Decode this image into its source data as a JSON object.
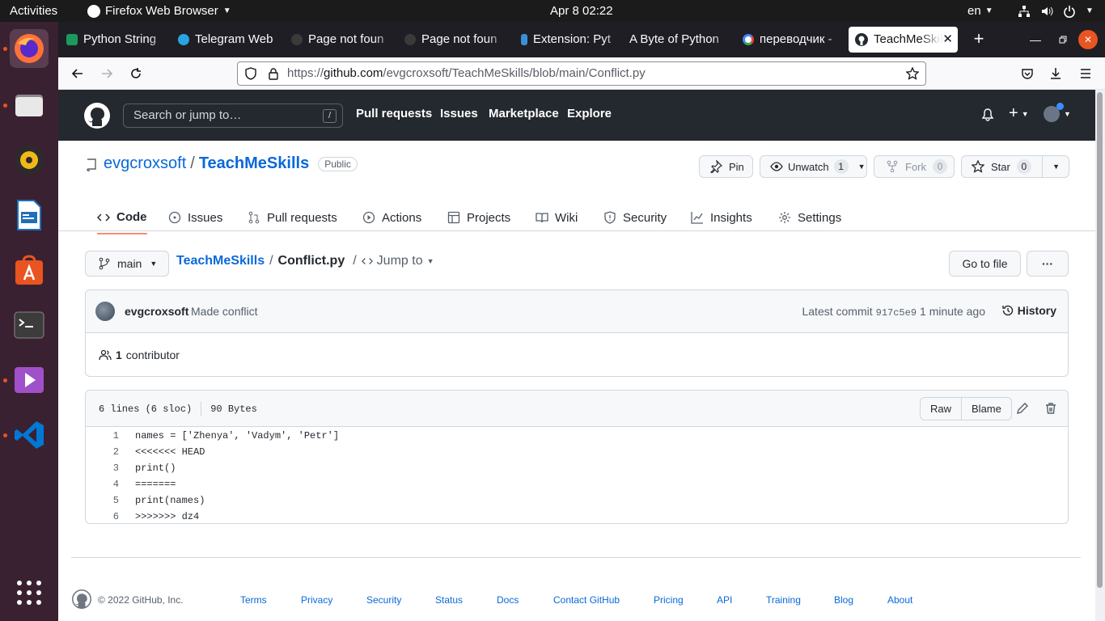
{
  "topbar": {
    "activities": "Activities",
    "app_name": "Firefox Web Browser",
    "clock": "Apr 8  02:22",
    "lang": "en"
  },
  "tabs": [
    {
      "title": "Python String",
      "fav_color": "#1c9a5e"
    },
    {
      "title": "Telegram Web",
      "fav_color": "#2aa3e0"
    },
    {
      "title": "Page not foun",
      "fav_color": "#3a3a3a"
    },
    {
      "title": "Page not foun",
      "fav_color": "#3a3a3a"
    },
    {
      "title": "Extension: Pyt",
      "fav_color": "#3c8fd6"
    },
    {
      "title": "A Byte of Python",
      "fav_color": ""
    },
    {
      "title": "переводчик - ",
      "fav_color": "#ea4335"
    },
    {
      "title": "TeachMeSkil",
      "fav_color": "#24292f"
    }
  ],
  "url": {
    "prefix": "https://",
    "host": "github.com",
    "path": "/evgcroxsoft/TeachMeSkills/blob/main/Conflict.py"
  },
  "gh": {
    "search_placeholder": "Search or jump to…",
    "search_key": "/",
    "nav": [
      "Pull requests",
      "Issues",
      "Marketplace",
      "Explore"
    ]
  },
  "repo": {
    "owner": "evgcroxsoft",
    "sep": "/",
    "name": "TeachMeSkills",
    "visibility": "Public",
    "pin": "Pin",
    "unwatch": "Unwatch",
    "unwatch_count": "1",
    "fork": "Fork",
    "fork_count": "0",
    "star": "Star",
    "star_count": "0",
    "tabs": [
      "Code",
      "Issues",
      "Pull requests",
      "Actions",
      "Projects",
      "Wiki",
      "Security",
      "Insights",
      "Settings"
    ]
  },
  "file": {
    "branch": "main",
    "crumb_repo": "TeachMeSkills",
    "crumb_sep": "/",
    "crumb_file": "Conflict.py",
    "crumb_sep2": "/",
    "jump_to": "Jump to",
    "go_to_file": "Go to file",
    "more": "···"
  },
  "commit": {
    "author": "evgcroxsoft",
    "message": "Made conflict",
    "latest_label": "Latest commit",
    "sha": "917c5e9",
    "time": "1 minute ago",
    "history": "History",
    "contrib_count": "1",
    "contrib_label": "contributor"
  },
  "blob": {
    "lines_info": "6 lines (6 sloc)",
    "size": "90 Bytes",
    "raw": "Raw",
    "blame": "Blame",
    "lines": [
      {
        "n": "1",
        "text": "names = ['Zhenya', 'Vadym', 'Petr']"
      },
      {
        "n": "2",
        "text": "<<<<<<< HEAD"
      },
      {
        "n": "3",
        "text": "print()"
      },
      {
        "n": "4",
        "text": "======="
      },
      {
        "n": "5",
        "text": "print(names)"
      },
      {
        "n": "6",
        "text": ">>>>>>> dz4"
      }
    ]
  },
  "footer": {
    "copyright": "© 2022 GitHub, Inc.",
    "links": [
      "Terms",
      "Privacy",
      "Security",
      "Status",
      "Docs",
      "Contact GitHub",
      "Pricing",
      "API",
      "Training",
      "Blog",
      "About"
    ]
  }
}
